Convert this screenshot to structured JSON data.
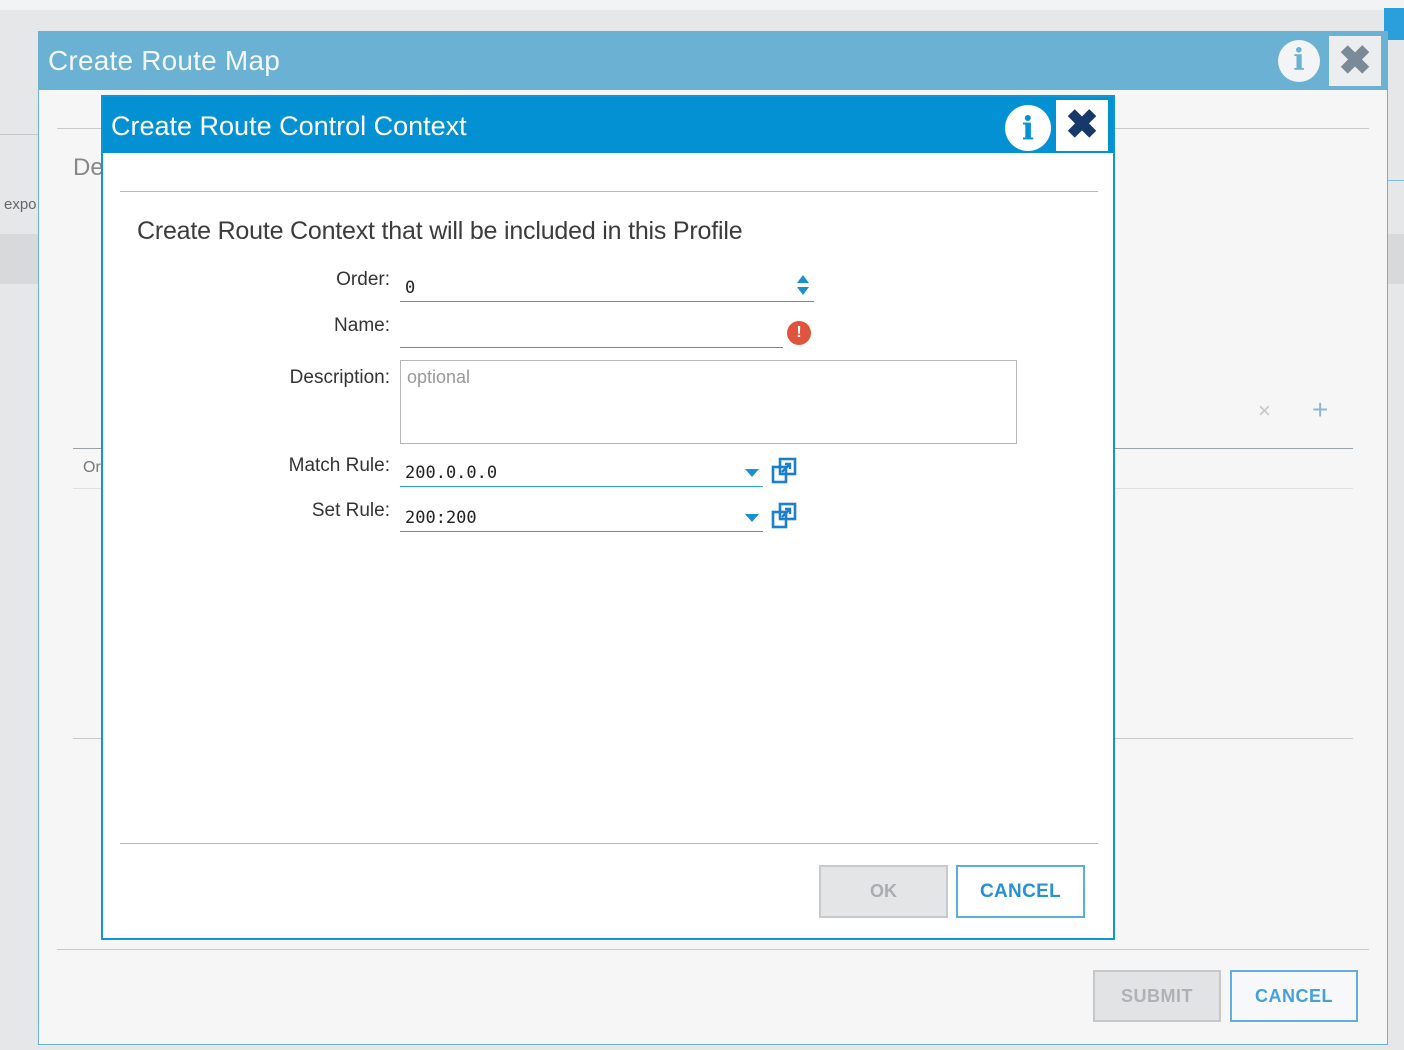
{
  "background": {
    "left_text": "expo"
  },
  "outer_dialog": {
    "title": "Create Route Map",
    "info_glyph": "i",
    "close_glyph": "✖",
    "section_label": "De",
    "table_header": "Or",
    "delete_glyph": "×",
    "add_glyph": "+",
    "submit_label": "SUBMIT",
    "cancel_label": "CANCEL"
  },
  "dialog": {
    "title": "Create Route Control Context",
    "info_glyph": "i",
    "close_glyph": "✖",
    "heading": "Create Route Context that will be included in this Profile",
    "fields": {
      "order": {
        "label": "Order:",
        "value": "0"
      },
      "name": {
        "label": "Name:",
        "value": "",
        "warning_glyph": "!"
      },
      "description": {
        "label": "Description:",
        "placeholder": "optional"
      },
      "match_rule": {
        "label": "Match Rule:",
        "value": "200.0.0.0"
      },
      "set_rule": {
        "label": "Set Rule:",
        "value": "200:200"
      }
    },
    "ok_label": "OK",
    "cancel_label": "CANCEL"
  },
  "colors": {
    "inner_header": "#0491d4",
    "outer_header": "#6ab1d3",
    "accent": "#2b9fdc",
    "warning": "#e0533c"
  },
  "icons": {
    "info": "info-icon",
    "close": "close-icon",
    "spinner": "spinner-icon",
    "warning": "warning-icon",
    "dropdown": "chevron-down-icon",
    "popout": "popout-icon"
  }
}
